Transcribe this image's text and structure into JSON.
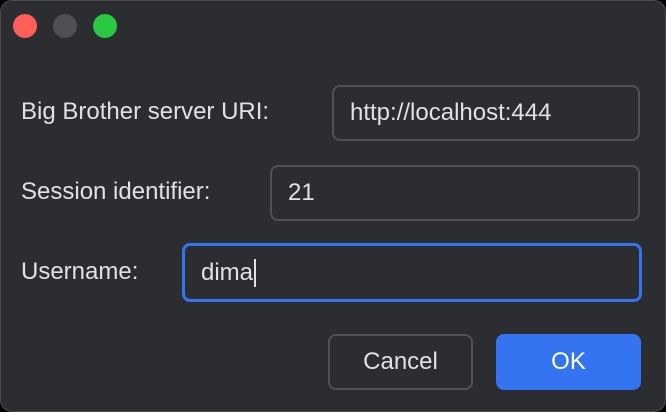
{
  "window": {
    "controls": [
      "close",
      "minimize",
      "zoom"
    ],
    "colors": {
      "background": "#2b2d30",
      "close": "#ff5f57",
      "minimize": "#4e5054",
      "zoom": "#28c840",
      "accent": "#3574f0",
      "text": "#dfe1e5"
    }
  },
  "form": {
    "server_uri": {
      "label": "Big Brother server URI:",
      "value": "http://localhost:444"
    },
    "session": {
      "label": "Session identifier:",
      "value": "21"
    },
    "username": {
      "label": "Username:",
      "value": "dima"
    }
  },
  "buttons": {
    "cancel_label": "Cancel",
    "ok_label": "OK"
  }
}
